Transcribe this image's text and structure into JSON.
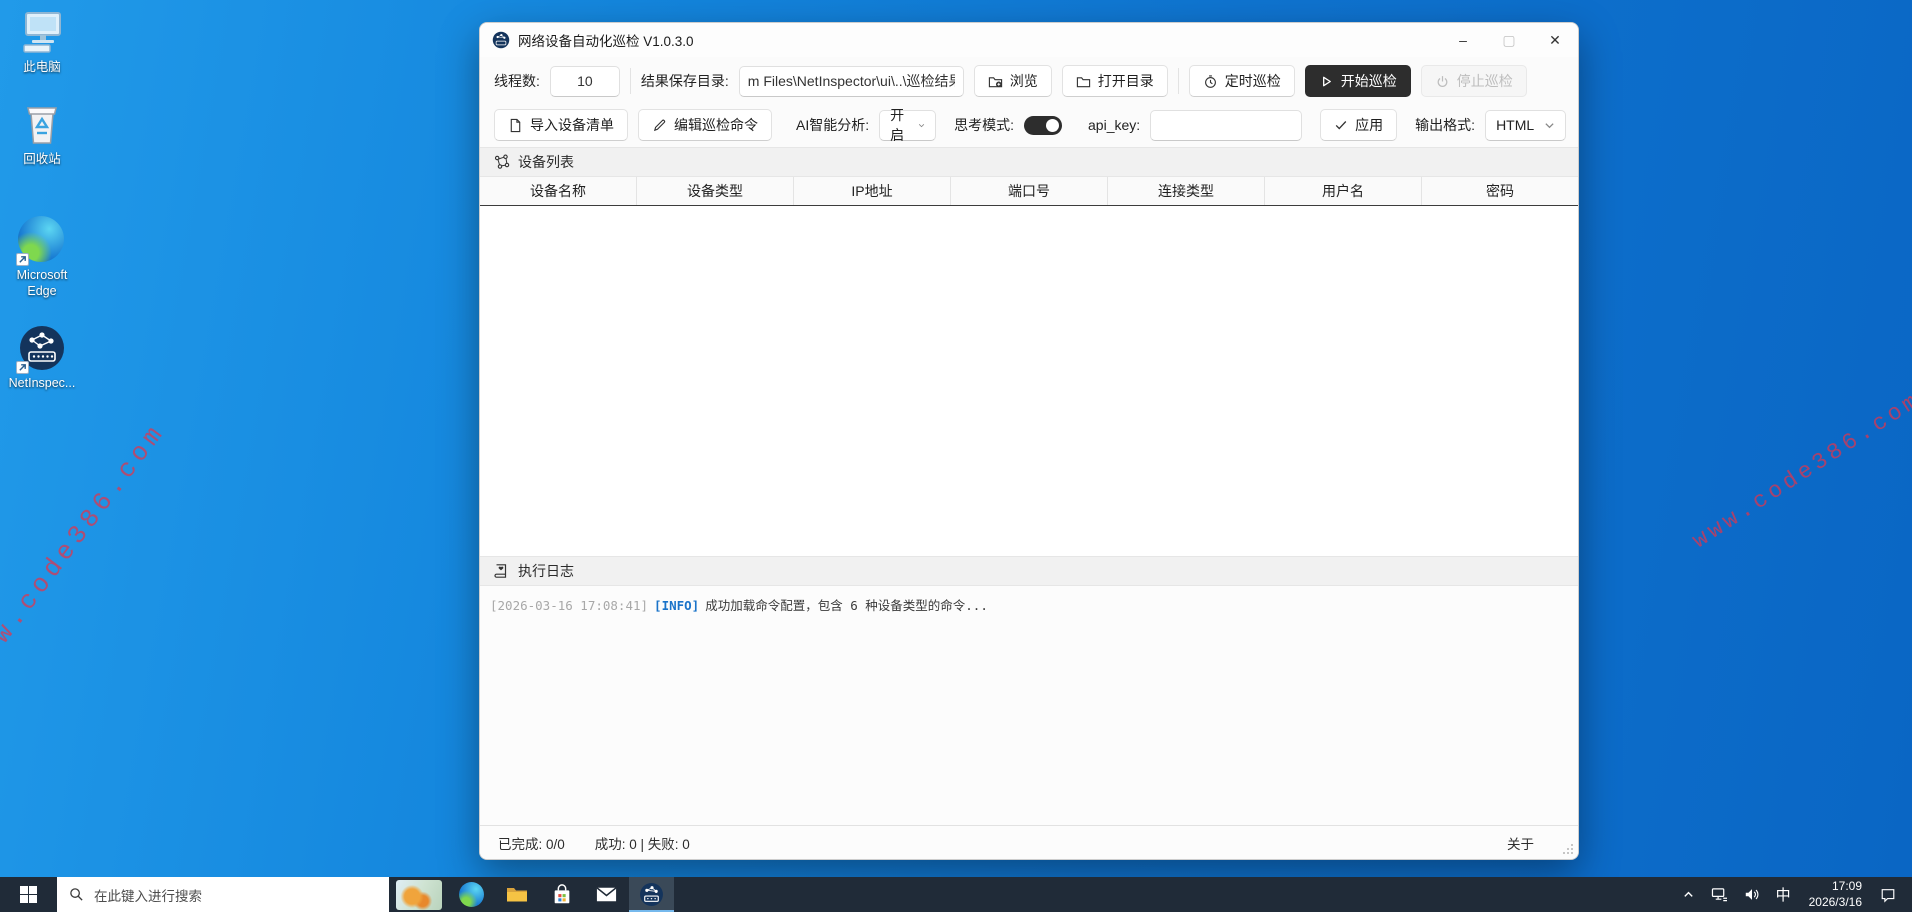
{
  "desktop": {
    "watermark": "www.code386.com",
    "icons": [
      {
        "label": "此电脑"
      },
      {
        "label": "回收站"
      },
      {
        "label": "Microsoft Edge"
      },
      {
        "label": "NetInspec..."
      }
    ]
  },
  "window": {
    "title": "网络设备自动化巡检 V1.0.3.0",
    "controls": {
      "minimize": "–",
      "maximize": "▢",
      "close": "✕"
    },
    "toolbar1": {
      "thread_label": "线程数:",
      "thread_value": "10",
      "save_dir_label": "结果保存目录:",
      "save_dir_value": "m Files\\NetInspector\\ui\\..\\巡检结果",
      "browse_label": "浏览",
      "open_dir_label": "打开目录",
      "schedule_label": "定时巡检",
      "start_label": "开始巡检",
      "stop_label": "停止巡检"
    },
    "toolbar2": {
      "import_label": "导入设备清单",
      "edit_cmd_label": "编辑巡检命令",
      "ai_label": "AI智能分析:",
      "ai_value": "开启",
      "think_label": "思考模式:",
      "api_key_label": "api_key:",
      "api_key_value": "",
      "apply_label": "应用",
      "format_label": "输出格式:",
      "format_value": "HTML"
    },
    "device_section": {
      "title": "设备列表",
      "columns": [
        "设备名称",
        "设备类型",
        "IP地址",
        "端口号",
        "连接类型",
        "用户名",
        "密码"
      ]
    },
    "log_section": {
      "title": "执行日志",
      "entries": [
        {
          "timestamp": "[2026-03-16 17:08:41]",
          "level": "[INFO]",
          "message": "成功加载命令配置，包含 6 种设备类型的命令..."
        }
      ]
    },
    "status_bar": {
      "completed": "已完成: 0/0",
      "result": "成功: 0 | 失败: 0",
      "about_label": "关于"
    }
  },
  "taskbar": {
    "search_placeholder": "在此键入进行搜索",
    "tray": {
      "ime": "中",
      "time": "17:09",
      "date": "2026/3/16"
    }
  }
}
